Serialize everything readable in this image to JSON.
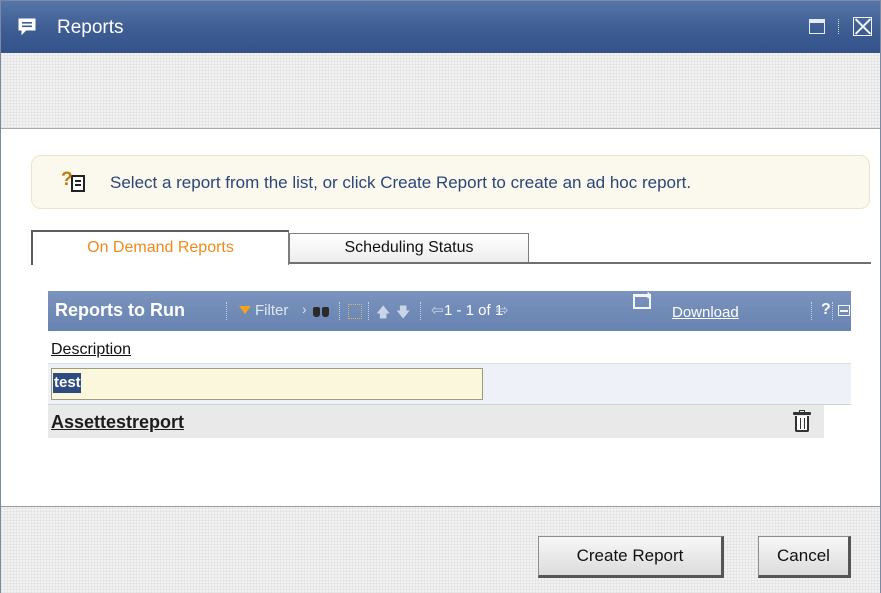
{
  "window": {
    "title": "Reports",
    "icon": "chat-bubble-icon"
  },
  "instruction": {
    "icon": "help-document-icon",
    "text": "Select a report from the list, or click Create Report to create an ad hoc report."
  },
  "tabs": [
    {
      "label": "On Demand Reports",
      "active": true
    },
    {
      "label": "Scheduling Status",
      "active": false
    }
  ],
  "grid": {
    "title": "Reports to Run",
    "filter_label": "Filter",
    "filter_caret": "›",
    "paging": "1 - 1 of 1",
    "download_label": "Download",
    "help_label": "?",
    "column_header": "Description",
    "filter_value": "test",
    "rows": [
      {
        "description": "Assettestreport"
      }
    ]
  },
  "buttons": {
    "create_report": "Create Report",
    "cancel": "Cancel"
  },
  "colors": {
    "titlebar": "#3d5d93",
    "grid_header": "#6f8ab6",
    "active_tab_text": "#f18a1b",
    "instruction_text": "#2c4577"
  }
}
